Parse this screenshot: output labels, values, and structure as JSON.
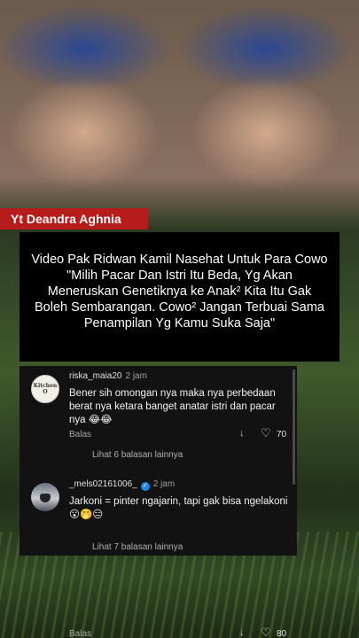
{
  "overlay_tag": "Yt Deandra Aghnia",
  "caption": "Video Pak Ridwan Kamil Nasehat Untuk Para Cowo \"Milih Pacar Dan Istri Itu Beda, Yg Akan Meneruskan Genetiknya ke Anak² Kita Itu Gak Boleh Sembarangan. Cowo² Jangan Terbuai Sama Penampilan Yg Kamu Suka Saja\"",
  "comments": [
    {
      "username": "riska_maia20",
      "time": "2 jam",
      "avatar_text": "Kitchen O",
      "text": "Bener sih omongan nya maka nya perbedaan berat nya ketara banget anatar istri dan pacar nya 😂😂",
      "reply_label": "Balas",
      "likes": "70",
      "more_replies": "Lihat 6 balasan lainnya"
    },
    {
      "username": "_mels02161006_",
      "time": "2 jam",
      "text": "Jarkoni = pinter ngajarin, tapi gak bisa ngelakoni😮🤭😑",
      "reply_label": "Balas",
      "likes": "80",
      "more_replies": "Lihat 7 balasan lainnya"
    }
  ],
  "colors": {
    "tag_bg": "#b71c1c",
    "panel_bg": "#121212",
    "caption_bg": "#000000",
    "verified": "#1e88e5"
  }
}
